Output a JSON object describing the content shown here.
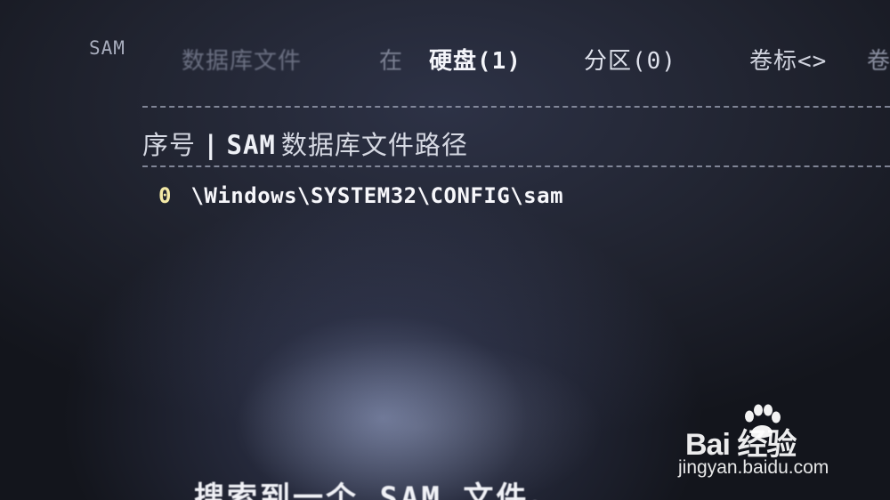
{
  "header": {
    "sam_label": "SAM",
    "db_file_label": "数据库文件",
    "at_label": "在",
    "disk_label": "硬盘(1)",
    "partition_label": "分区(0)",
    "volume_label": "卷标<>",
    "truncated_label": "卷"
  },
  "table": {
    "col_index": "序号",
    "col_separator": "|",
    "col_sam": "SAM",
    "col_path": "数据库文件路径",
    "rows": [
      {
        "index": "0",
        "path": "\\Windows\\SYSTEM32\\CONFIG\\sam"
      }
    ]
  },
  "footer": {
    "message": "搜索到一个 SAM 文件。"
  },
  "watermark": {
    "logo_text": "Bai  经验",
    "url": "jingyan.baidu.com",
    "icon": "paw-icon"
  },
  "colors": {
    "background": "#1c2030",
    "text": "#f7f7fb",
    "index": "#f3e9a6"
  }
}
